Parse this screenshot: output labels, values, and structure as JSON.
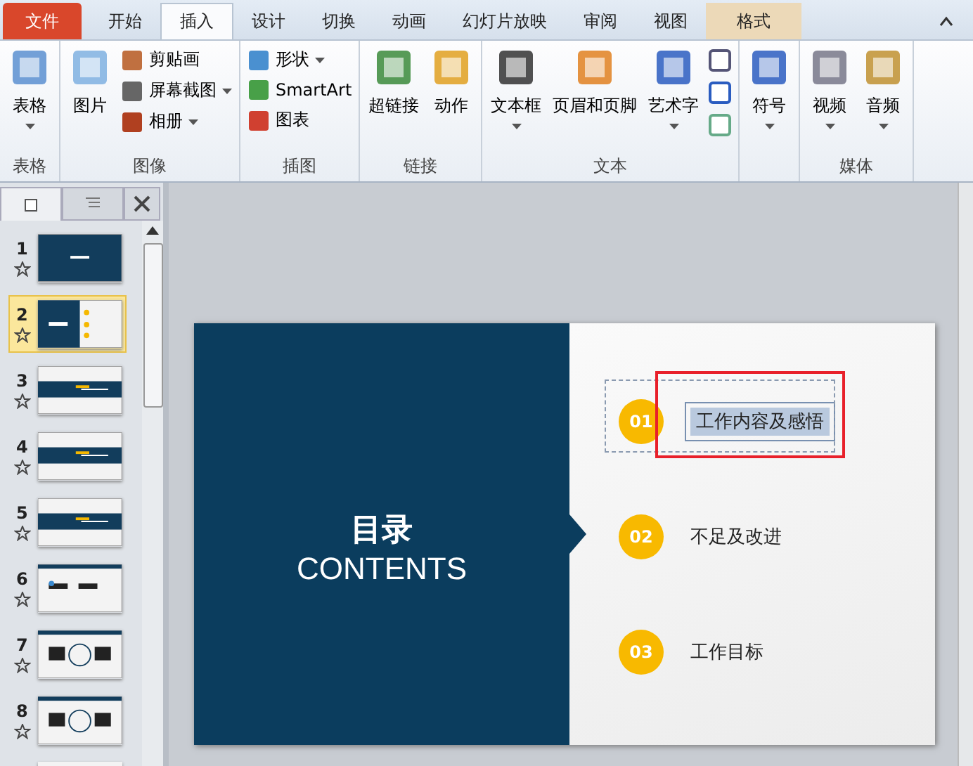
{
  "tabs": [
    {
      "label": "文件",
      "kind": "file",
      "selected": false
    },
    {
      "label": "开始",
      "kind": "normal",
      "selected": false
    },
    {
      "label": "插入",
      "kind": "normal",
      "selected": true
    },
    {
      "label": "设计",
      "kind": "normal",
      "selected": false
    },
    {
      "label": "切换",
      "kind": "normal",
      "selected": false
    },
    {
      "label": "动画",
      "kind": "normal",
      "selected": false
    },
    {
      "label": "幻灯片放映",
      "kind": "normal",
      "selected": false
    },
    {
      "label": "审阅",
      "kind": "normal",
      "selected": false
    },
    {
      "label": "视图",
      "kind": "normal",
      "selected": false
    },
    {
      "label": "格式",
      "kind": "contextual",
      "selected": false
    }
  ],
  "ribbon_groups": [
    {
      "label": "表格",
      "items": [
        {
          "kind": "large",
          "label": "表格",
          "dropdown": true
        }
      ]
    },
    {
      "label": "图像",
      "items": [
        {
          "kind": "large",
          "label": "图片",
          "dropdown": false
        },
        {
          "kind": "small",
          "label": "剪贴画",
          "dropdown": false
        },
        {
          "kind": "small",
          "label": "屏幕截图",
          "dropdown": true
        },
        {
          "kind": "small",
          "label": "相册",
          "dropdown": true
        }
      ]
    },
    {
      "label": "插图",
      "items": [
        {
          "kind": "small",
          "label": "形状",
          "dropdown": true
        },
        {
          "kind": "small",
          "label": "SmartArt",
          "dropdown": false
        },
        {
          "kind": "small",
          "label": "图表",
          "dropdown": false
        }
      ]
    },
    {
      "label": "链接",
      "items": [
        {
          "kind": "large",
          "label": "超链接",
          "dropdown": false
        },
        {
          "kind": "large",
          "label": "动作",
          "dropdown": false
        }
      ]
    },
    {
      "label": "文本",
      "items": [
        {
          "kind": "large",
          "label": "文本框",
          "dropdown": true
        },
        {
          "kind": "large",
          "label": "页眉和页脚",
          "dropdown": false
        },
        {
          "kind": "large",
          "label": "艺术字",
          "dropdown": true
        },
        {
          "kind": "icon"
        },
        {
          "kind": "icon"
        },
        {
          "kind": "icon"
        }
      ]
    },
    {
      "items": [
        {
          "kind": "large",
          "label": "符号",
          "dropdown": true
        }
      ]
    },
    {
      "label": "媒体",
      "items": [
        {
          "kind": "large",
          "label": "视频",
          "dropdown": true
        },
        {
          "kind": "large",
          "label": "音频",
          "dropdown": true
        }
      ]
    }
  ],
  "slides": [
    {
      "number": "1",
      "kind": "title",
      "selected": false
    },
    {
      "number": "2",
      "kind": "agenda",
      "selected": true
    },
    {
      "number": "3",
      "kind": "section",
      "selected": false
    },
    {
      "number": "4",
      "kind": "section",
      "selected": false
    },
    {
      "number": "5",
      "kind": "section",
      "selected": false
    },
    {
      "number": "6",
      "kind": "diagram",
      "selected": false
    },
    {
      "number": "7",
      "kind": "circle",
      "selected": false
    },
    {
      "number": "8",
      "kind": "circle",
      "selected": false
    }
  ],
  "slide": {
    "title": "目录",
    "subtitle": "CONTENTS",
    "items": [
      {
        "number": "01",
        "text": "工作内容及感悟",
        "selected": true,
        "annotated": true
      },
      {
        "number": "02",
        "text": "不足及改进",
        "selected": false,
        "annotated": false
      },
      {
        "number": "03",
        "text": "工作目标",
        "selected": false,
        "annotated": false
      }
    ]
  }
}
